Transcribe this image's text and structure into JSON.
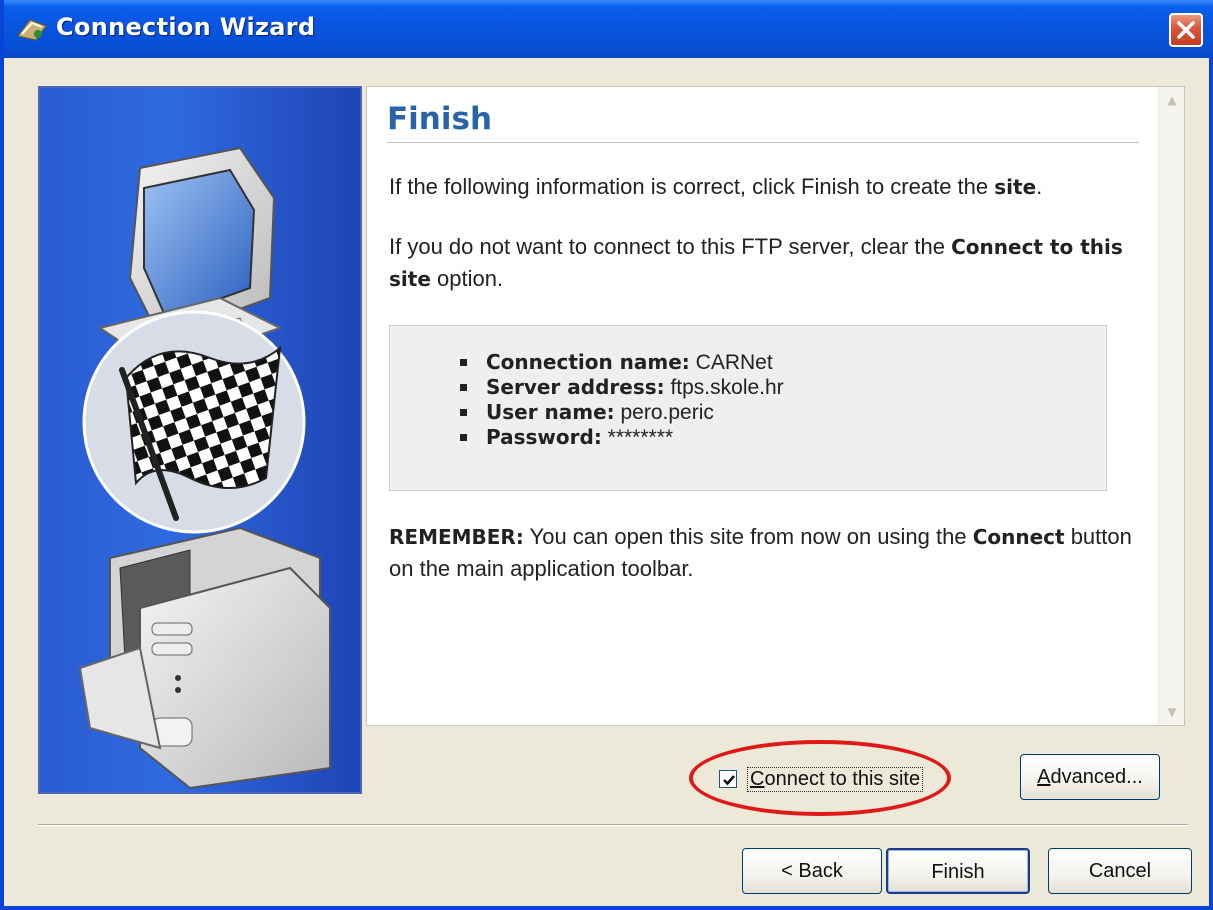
{
  "window": {
    "title": "Connection Wizard",
    "close_icon": "close-icon",
    "colors": {
      "titlebar": "#0A55E2",
      "accent": "#2A64A8",
      "highlight": "#E01818"
    }
  },
  "illustration": {
    "icon": "checkered-flag-computers-illustration"
  },
  "page": {
    "heading": "Finish",
    "p1_prefix": "If the following information is correct, click Finish to create the ",
    "p1_bold": "site",
    "p1_suffix": ".",
    "p2_prefix": "If you do not want to connect to this FTP server, clear the ",
    "p2_bold": "Connect to this site",
    "p2_suffix": " option.",
    "info": [
      {
        "label": "Connection name:",
        "value": " CARNet"
      },
      {
        "label": "Server address:",
        "value": " ftps.skole.hr"
      },
      {
        "label": "User name:",
        "value": " pero.peric"
      },
      {
        "label": "Password:",
        "value": " ********"
      }
    ],
    "remember_bold": "REMEMBER:",
    "remember_text": " You can open this site from now on using the ",
    "remember_bold2": "Connect",
    "remember_text2": " button on the main application toolbar."
  },
  "controls": {
    "connect_checkbox": {
      "label_mnemonic": "C",
      "label_rest": "onnect to this site",
      "checked": true
    },
    "advanced_button": {
      "mnemonic": "A",
      "rest": "dvanced..."
    },
    "back_button": "< Back",
    "finish_button": "Finish",
    "cancel_button": "Cancel"
  }
}
